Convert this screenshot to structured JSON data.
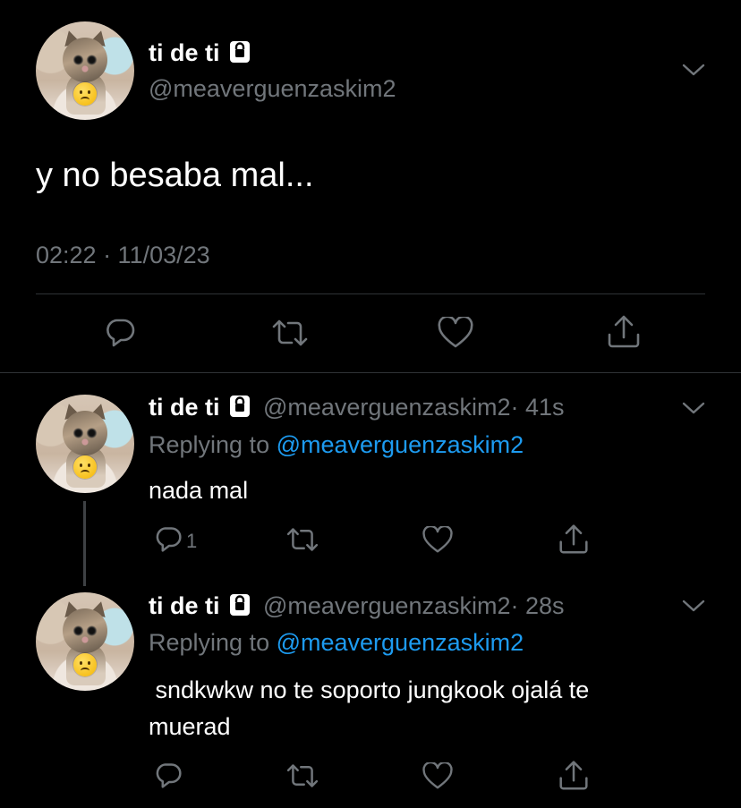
{
  "main_tweet": {
    "display_name": "ti de ti",
    "handle": "@meaverguenzaskim2",
    "text": "y no besaba mal...",
    "timestamp": "02:22 · 11/03/23"
  },
  "replies": [
    {
      "display_name": "ti de ti",
      "handle": "@meaverguenzaskim2",
      "age": "· 41s",
      "replying_label": "Replying to ",
      "replying_handle": "@meaverguenzaskim2",
      "text": "nada mal",
      "reply_count": "1"
    },
    {
      "display_name": "ti de ti",
      "handle": "@meaverguenzaskim2",
      "age": "· 28s",
      "replying_label": "Replying to ",
      "replying_handle": "@meaverguenzaskim2",
      "text_line1": " sndkwkw no te soporto jungkook ojalá te",
      "text_line2": "muerad"
    }
  ],
  "icons": {
    "reply": "reply-icon",
    "retweet": "retweet-icon",
    "like": "like-icon",
    "share": "share-icon",
    "lock": "lock-icon",
    "more": "chevron-down-icon"
  },
  "colors": {
    "background": "#000000",
    "text": "#ffffff",
    "muted": "#71767b",
    "link": "#1d9bf0",
    "divider": "#2f3336"
  }
}
